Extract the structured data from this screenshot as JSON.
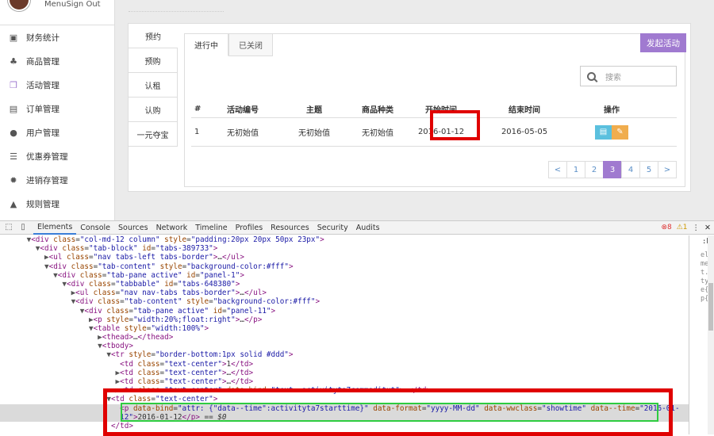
{
  "header": {
    "menu_sign_out": "MenuSign Out"
  },
  "sidebar": {
    "items": [
      {
        "label": "财务统计",
        "icon": "finance-icon",
        "glyph": "▣"
      },
      {
        "label": "商品管理",
        "icon": "sitemap-icon",
        "glyph": "♣"
      },
      {
        "label": "活动管理",
        "icon": "gift-icon",
        "glyph": "❒"
      },
      {
        "label": "订单管理",
        "icon": "file-icon",
        "glyph": "▤"
      },
      {
        "label": "用户管理",
        "icon": "user-icon",
        "glyph": "●"
      },
      {
        "label": "优惠券管理",
        "icon": "list-icon",
        "glyph": "☰"
      },
      {
        "label": "进销存管理",
        "icon": "gear-icon",
        "glyph": "✹"
      },
      {
        "label": "规则管理",
        "icon": "bell-icon",
        "glyph": "▲"
      }
    ]
  },
  "left_tabs": [
    "预约",
    "预购",
    "认租",
    "认购",
    "一元夺宝"
  ],
  "top_tabs": [
    "进行中",
    "已关闭"
  ],
  "launch_button": "发起活动",
  "search": {
    "placeholder": "搜索"
  },
  "table": {
    "headers": [
      "#",
      "活动编号",
      "主题",
      "商品种类",
      "开始时间",
      "结束时间",
      "操作"
    ],
    "row": [
      "1",
      "无初始值",
      "无初始值",
      "无初始值",
      "2016-01-12",
      "2016-05-05"
    ]
  },
  "pager": [
    "<",
    "1",
    "2",
    "3",
    "4",
    "5",
    ">"
  ],
  "pager_active": "3",
  "devtools": {
    "tabs": [
      "Elements",
      "Console",
      "Sources",
      "Network",
      "Timeline",
      "Profiles",
      "Resources",
      "Security",
      "Audits"
    ],
    "errors": "8",
    "warnings": "1",
    "close": "✕",
    "side_label": ":ho",
    "side_chars": "element.style{}p{"
  },
  "dom_lines": [
    {
      "indent": 3,
      "tri": "▼",
      "html": "<span class=\"tag\">&lt;div</span> <span class=\"an\">class</span>=<span class=\"av\">\"col-md-12 column\"</span> <span class=\"an\">style</span>=<span class=\"av\">\"padding:20px 20px 50px 23px\"</span><span class=\"tag\">&gt;</span>"
    },
    {
      "indent": 4,
      "tri": "▼",
      "html": "<span class=\"tag\">&lt;div</span> <span class=\"an\">class</span>=<span class=\"av\">\"tab-block\"</span> <span class=\"an\">id</span>=<span class=\"av\">\"tabs-389733\"</span><span class=\"tag\">&gt;</span>"
    },
    {
      "indent": 5,
      "tri": "▶",
      "html": "<span class=\"tag\">&lt;ul</span> <span class=\"an\">class</span>=<span class=\"av\">\"nav tabs-left tabs-border\"</span><span class=\"tag\">&gt;</span>…<span class=\"tag\">&lt;/ul&gt;</span>"
    },
    {
      "indent": 5,
      "tri": "▼",
      "html": "<span class=\"tag\">&lt;div</span> <span class=\"an\">class</span>=<span class=\"av\">\"tab-content\"</span> <span class=\"an\">style</span>=<span class=\"av\">\"background-color:#fff\"</span><span class=\"tag\">&gt;</span>"
    },
    {
      "indent": 6,
      "tri": "▼",
      "html": "<span class=\"tag\">&lt;div</span> <span class=\"an\">class</span>=<span class=\"av\">\"tab-pane active\"</span> <span class=\"an\">id</span>=<span class=\"av\">\"panel-1\"</span><span class=\"tag\">&gt;</span>"
    },
    {
      "indent": 7,
      "tri": "▼",
      "html": "<span class=\"tag\">&lt;div</span> <span class=\"an\">class</span>=<span class=\"av\">\"tabbable\"</span> <span class=\"an\">id</span>=<span class=\"av\">\"tabs-648380\"</span><span class=\"tag\">&gt;</span>"
    },
    {
      "indent": 8,
      "tri": "▶",
      "html": "<span class=\"tag\">&lt;ul</span> <span class=\"an\">class</span>=<span class=\"av\">\"nav nav-tabs tabs-border\"</span><span class=\"tag\">&gt;</span>…<span class=\"tag\">&lt;/ul&gt;</span>"
    },
    {
      "indent": 8,
      "tri": "▼",
      "html": "<span class=\"tag\">&lt;div</span> <span class=\"an\">class</span>=<span class=\"av\">\"tab-content\"</span> <span class=\"an\">style</span>=<span class=\"av\">\"background-color:#fff\"</span><span class=\"tag\">&gt;</span>"
    },
    {
      "indent": 9,
      "tri": "▼",
      "html": "<span class=\"tag\">&lt;div</span> <span class=\"an\">class</span>=<span class=\"av\">\"tab-pane active\"</span> <span class=\"an\">id</span>=<span class=\"av\">\"panel-11\"</span><span class=\"tag\">&gt;</span>"
    },
    {
      "indent": 10,
      "tri": "▶",
      "html": "<span class=\"tag\">&lt;p</span> <span class=\"an\">style</span>=<span class=\"av\">\"width:20%;float:right\"</span><span class=\"tag\">&gt;</span>…<span class=\"tag\">&lt;/p&gt;</span>"
    },
    {
      "indent": 10,
      "tri": "▼",
      "html": "<span class=\"tag\">&lt;table</span> <span class=\"an\">style</span>=<span class=\"av\">\"width:100%\"</span><span class=\"tag\">&gt;</span>"
    },
    {
      "indent": 11,
      "tri": "▶",
      "html": "<span class=\"tag\">&lt;thead&gt;</span>…<span class=\"tag\">&lt;/thead&gt;</span>"
    },
    {
      "indent": 11,
      "tri": "▼",
      "html": "<span class=\"tag\">&lt;tbody&gt;</span>"
    },
    {
      "indent": 12,
      "tri": "▼",
      "html": "<span class=\"tag\">&lt;tr</span> <span class=\"an\">style</span>=<span class=\"av\">\"border-bottom:1px solid #ddd\"</span><span class=\"tag\">&gt;</span>"
    },
    {
      "indent": 13,
      "tri": " ",
      "html": "<span class=\"tag\">&lt;td</span> <span class=\"an\">class</span>=<span class=\"av\">\"text-center\"</span><span class=\"tag\">&gt;</span>1<span class=\"tag\">&lt;/td&gt;</span>"
    },
    {
      "indent": 13,
      "tri": "▶",
      "html": "<span class=\"tag\">&lt;td</span> <span class=\"an\">class</span>=<span class=\"av\">\"text-center\"</span><span class=\"tag\">&gt;</span>…<span class=\"tag\">&lt;/td&gt;</span>"
    },
    {
      "indent": 13,
      "tri": "▶",
      "html": "<span class=\"tag\">&lt;td</span> <span class=\"an\">class</span>=<span class=\"av\">\"text-center\"</span><span class=\"tag\">&gt;</span>…<span class=\"tag\">&lt;/td&gt;</span>"
    },
    {
      "indent": 13,
      "tri": "▶",
      "html": "<span class=\"tag\">&lt;td</span> <span class=\"an\">class</span>=<span class=\"av\">\"text-center\"</span> <span class=\"an\">data-bind</span>=<span class=\"av\">\"text: activityta7commoditut\"</span><span class=\"tag\">&gt;</span>…<span class=\"tag\">&lt;/td&gt;</span>"
    },
    {
      "indent": 12,
      "tri": "▼",
      "html": "<span class=\"tag\">&lt;td</span> <span class=\"an\">class</span>=<span class=\"av\">\"text-center\"</span><span class=\"tag\">&gt;</span>"
    },
    {
      "indent": 13,
      "tri": " ",
      "sel": true,
      "html": "<span class=\"tag\">&lt;p</span> <span class=\"an\">data-bind</span>=<span class=\"av\">\"attr: {\"data--time\":activityta7starttime}\"</span> <span class=\"an\">data-format</span>=<span class=\"av\">\"yyyy-MM-dd\"</span> <span class=\"an\">data-wwclass</span>=<span class=\"av\">\"showtime\"</span> <span class=\"an\">data--time</span>=<span class=\"av\">\"2016-01-</span>"
    },
    {
      "indent": 13,
      "tri": " ",
      "sel": true,
      "html": "<span class=\"av\">12\"</span><span class=\"tag\">&gt;</span>2016-01-12<span class=\"tag\">&lt;/p&gt;</span> == <i>$0</i>"
    },
    {
      "indent": 12,
      "tri": " ",
      "html": "<span class=\"tag\">&lt;/td&gt;</span>"
    }
  ]
}
